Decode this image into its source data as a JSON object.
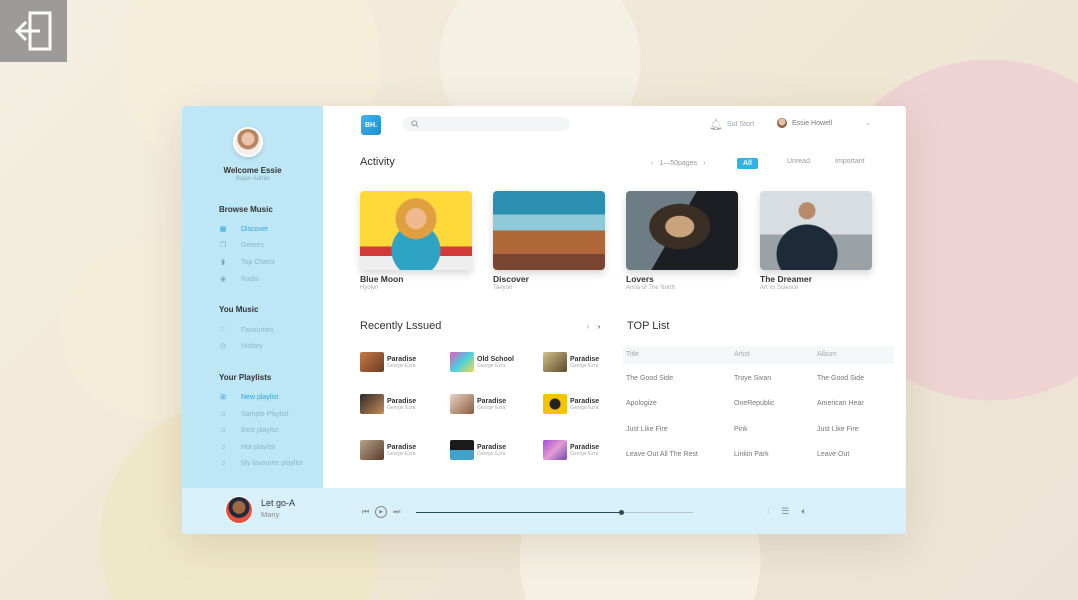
{
  "sidebar": {
    "welcome": "Welcome Essie",
    "role": "Super Admin",
    "browse_title": "Browse Music",
    "browse": [
      {
        "label": "Discover",
        "icon": "grid-icon",
        "active": true
      },
      {
        "label": "Genres",
        "icon": "copy-icon",
        "active": false
      },
      {
        "label": "Top Charts",
        "icon": "bar-chart-icon",
        "active": false
      },
      {
        "label": "Radio",
        "icon": "radio-icon",
        "active": false
      }
    ],
    "you_title": "You Music",
    "you": [
      {
        "label": "Favourites",
        "icon": "heart-icon"
      },
      {
        "label": "History",
        "icon": "clock-icon"
      }
    ],
    "playlists_title": "Your Playlists",
    "playlists": [
      {
        "label": "New playlist",
        "icon": "add-playlist-icon",
        "active": true
      },
      {
        "label": "Sample Plsylist",
        "icon": "music-note-icon"
      },
      {
        "label": "Best playlist",
        "icon": "music-note-icon"
      },
      {
        "label": "Hot playlist",
        "icon": "music-note-icon"
      },
      {
        "label": "My favourite playlist",
        "icon": "music-note-icon"
      }
    ]
  },
  "header": {
    "logo": "BH.",
    "search_placeholder": "",
    "notification": "Sot Stort",
    "user": "Essie Howell"
  },
  "activity": {
    "title": "Activity",
    "pager": "1—50pages",
    "filters": [
      "All",
      "Unread",
      "Important"
    ],
    "cards": [
      {
        "title": "Blue Moon",
        "sub": "Hyolyn"
      },
      {
        "title": "Discover",
        "sub": "Taeyon"
      },
      {
        "title": "Lovers",
        "sub": "Anna of The North"
      },
      {
        "title": "The Dreamer",
        "sub": "Art vs Science"
      }
    ]
  },
  "recent": {
    "title": "Recently Lssued",
    "items": [
      {
        "title": "Paradise",
        "sub": "George Ezra"
      },
      {
        "title": "Old School",
        "sub": "George Ezra"
      },
      {
        "title": "Paradise",
        "sub": "George Ezra"
      },
      {
        "title": "Paradise",
        "sub": "George Ezra"
      },
      {
        "title": "Paradise",
        "sub": "George Ezra"
      },
      {
        "title": "Paradise",
        "sub": "George Ezra"
      },
      {
        "title": "Paradise",
        "sub": "George Ezra"
      },
      {
        "title": "Paradise",
        "sub": "George Ezra"
      },
      {
        "title": "Paradise",
        "sub": "George Ezra"
      }
    ]
  },
  "toplist": {
    "title": "TOP List",
    "columns": [
      "Title",
      "Artist",
      "Album"
    ],
    "rows": [
      [
        "The Good Side",
        "Troye Sivan",
        "The Good Side"
      ],
      [
        "Apologize",
        "OneRepublic",
        "American Hear"
      ],
      [
        "Just Like Fire",
        "Pink",
        "Just Like Fire"
      ],
      [
        "Leave Out All The Rest",
        "Linkin Park",
        "Leave Out"
      ]
    ]
  },
  "player": {
    "title": "Let go-A",
    "artist": "Many",
    "progress": 0.74
  },
  "colors": {
    "accent": "#2db3ea",
    "sidebar": "#bde6f6",
    "player": "#d8f0fa"
  }
}
